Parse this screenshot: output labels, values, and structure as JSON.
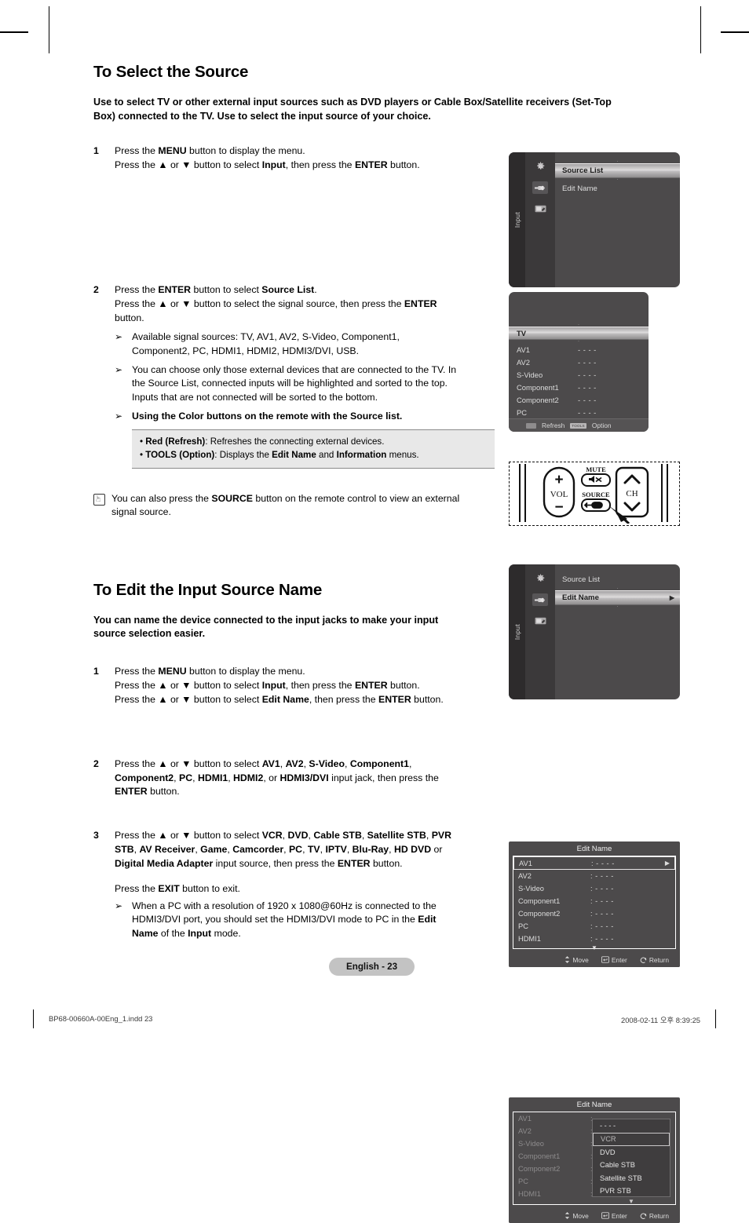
{
  "doc": {
    "page_badge": "English - 23",
    "footer_left": "BP68-00660A-00Eng_1.indd   23",
    "footer_right": "2008-02-11   오후 8:39:25"
  },
  "section1": {
    "title": "To Select the Source",
    "lead_line1": "Use to select TV or other external input sources such as DVD players or Cable Box/Satellite receivers (Set-Top",
    "lead_line2": "Box) connected to the TV. Use to select the input source of your choice.",
    "step1": {
      "num": "1",
      "line1_a": "Press the ",
      "line1_b": "MENU",
      "line1_c": " button to display the menu.",
      "line2_a": "Press the ▲ or ▼ button to select ",
      "line2_b": "Input",
      "line2_c": ", then press the ",
      "line2_d": "ENTER",
      "line2_e": " button."
    },
    "step2": {
      "num": "2",
      "line1_a": "Press the ",
      "line1_b": "ENTER",
      "line1_c": " button to select ",
      "line1_d": "Source List",
      "line1_e": ".",
      "line2_a": "Press the ▲ or ▼ button to select the signal source, then press the ",
      "line2_b": "ENTER",
      "line3": "button.",
      "bullet1_l1": "Available signal sources: TV,  AV1, AV2, S-Video, Component1,",
      "bullet1_l2": "Component2, PC, HDMI1, HDMI2, HDMI3/DVI, USB.",
      "bullet2_l1": "You can choose only those external devices that are connected to the TV. In",
      "bullet2_l2": "the Source List, connected inputs will be highlighted and sorted to the top.",
      "bullet2_l3": "Inputs that are not connected will be sorted to the bottom.",
      "bullet3": "Using the Color buttons on the remote with the Source list.",
      "info1_bold": "Red (Refresh)",
      "info1_rest": ": Refreshes the connecting external devices.",
      "info2_bold": "TOOLS (Option)",
      "info2_mid": ": Displays the ",
      "info2_b2": "Edit Name",
      "info2_mid2": " and ",
      "info2_b3": "Information",
      "info2_end": " menus."
    },
    "note": {
      "icon": "hand-pointer-icon",
      "l1_a": "You can also press the ",
      "l1_b": "SOURCE",
      "l1_c": " button on the remote control to view an external",
      "l2": "signal source."
    }
  },
  "section2": {
    "title": "To Edit the Input Source Name",
    "lead_line1": "You can name the device connected to the input jacks to make your input",
    "lead_line2": "source selection easier.",
    "step1": {
      "num": "1",
      "line1_a": "Press the ",
      "line1_b": "MENU",
      "line1_c": " button to display the menu.",
      "line2_a": "Press the ▲ or ▼ button to select ",
      "line2_b": "Input",
      "line2_c": ", then press the ",
      "line2_d": "ENTER",
      "line2_e": " button.",
      "line3_a": "Press the ▲ or ▼ button to select ",
      "line3_b": "Edit Name",
      "line3_c": ", then press the ",
      "line3_d": "ENTER",
      "line3_e": " button."
    },
    "step2": {
      "num": "2",
      "l1_a": "Press the ▲ or ▼ button to select ",
      "l1_b": "AV1",
      "l1_c": ", ",
      "l1_d": "AV2",
      "l1_e": ", ",
      "l1_f": "S-Video",
      "l1_g": ", ",
      "l1_h": "Component1",
      "l1_i": ",",
      "l2_a": "Component2",
      "l2_b": ", ",
      "l2_c": "PC",
      "l2_d": ", ",
      "l2_e": "HDMI1",
      "l2_f": ", ",
      "l2_g": "HDMI2",
      "l2_h": ", or ",
      "l2_i": "HDMI3/DVI",
      "l2_j": " input jack, then press the",
      "l3_a": "ENTER",
      "l3_b": " button."
    },
    "step3": {
      "num": "3",
      "l1_a": "Press the ▲ or ▼ button to select ",
      "l1_b": "VCR",
      "l1_c": ", ",
      "l1_d": "DVD",
      "l1_e": ", ",
      "l1_f": "Cable STB",
      "l1_g": ", ",
      "l1_h": "Satellite STB",
      "l1_i": ", ",
      "l1_j": "PVR",
      "l2_a": "STB",
      "l2_b": ", ",
      "l2_c": "AV Receiver",
      "l2_d": ", ",
      "l2_e": "Game",
      "l2_f": ", ",
      "l2_g": "Camcorder",
      "l2_h": ", ",
      "l2_i": "PC",
      "l2_j": ", ",
      "l2_k": "TV",
      "l2_l": ", ",
      "l2_m": "IPTV",
      "l2_n": ", ",
      "l2_o": "Blu-Ray",
      "l2_p": ", ",
      "l2_q": "HD DVD",
      "l2_r": " or",
      "l3_a": "Digital Media Adapter",
      "l3_b": " input source, then press the ",
      "l3_c": "ENTER",
      "l3_d": " button.",
      "exit_a": "Press the ",
      "exit_b": "EXIT",
      "exit_c": " button to exit.",
      "bullet_l1": "When a PC with a resolution of 1920 x 1080@60Hz is connected to the",
      "bullet_l2_a": "HDMI3/DVI port, you should set the HDMI3/DVI mode to PC in the ",
      "bullet_l2_b": "Edit",
      "bullet_l3_a": "Name",
      "bullet_l3_b": " of the ",
      "bullet_l3_c": "Input",
      "bullet_l3_d": " mode."
    }
  },
  "osd": {
    "input_menu_1": {
      "tab_label": "Input",
      "icons": [
        "gear-icon",
        "plug-icon",
        "edit-picture-icon"
      ],
      "items": [
        {
          "label": "Source List",
          "selected": true
        },
        {
          "label": "Edit Name",
          "selected": false
        }
      ]
    },
    "input_menu_2": {
      "tab_label": "Input",
      "icons": [
        "gear-icon",
        "plug-icon",
        "edit-picture-icon"
      ],
      "items": [
        {
          "label": "Source List",
          "selected": false
        },
        {
          "label": "Edit Name",
          "selected": true,
          "caret": "▶"
        }
      ]
    },
    "source_list": {
      "rows": [
        {
          "name": "TV",
          "value": "",
          "selected": true
        },
        {
          "name": "AV1",
          "value": "- - - -",
          "selected": false
        },
        {
          "name": "AV2",
          "value": "- - - -",
          "selected": false
        },
        {
          "name": "S-Video",
          "value": "- - - -",
          "selected": false
        },
        {
          "name": "Component1",
          "value": "- - - -",
          "selected": false
        },
        {
          "name": "Component2",
          "value": "- - - -",
          "selected": false
        },
        {
          "name": "PC",
          "value": "- - - -",
          "selected": false
        }
      ],
      "footer": {
        "refresh": "Refresh",
        "tools_key": "TOOLS",
        "option": "Option"
      }
    },
    "edit_name_list": {
      "title": "Edit Name",
      "rows": [
        {
          "name": "AV1",
          "value": ": - - - -",
          "selected": true,
          "caret": "▶"
        },
        {
          "name": "AV2",
          "value": ": - - - -",
          "selected": false
        },
        {
          "name": "S-Video",
          "value": ": - - - -",
          "selected": false
        },
        {
          "name": "Component1",
          "value": ": - - - -",
          "selected": false
        },
        {
          "name": "Component2",
          "value": ": - - - -",
          "selected": false
        },
        {
          "name": "PC",
          "value": ": - - - -",
          "selected": false
        },
        {
          "name": "HDMI1",
          "value": ": - - - -",
          "selected": false
        }
      ],
      "scroll_down": "▼",
      "footer": {
        "move": "Move",
        "enter": "Enter",
        "return": "Return"
      }
    },
    "edit_name_dropdown": {
      "title": "Edit Name",
      "rows": [
        {
          "name": "AV1",
          "value": ":"
        },
        {
          "name": "AV2",
          "value": ":"
        },
        {
          "name": "S-Video",
          "value": ":"
        },
        {
          "name": "Component1",
          "value": ":"
        },
        {
          "name": "Component2",
          "value": ":"
        },
        {
          "name": "PC",
          "value": ":"
        },
        {
          "name": "HDMI1",
          "value": ":"
        }
      ],
      "options": [
        {
          "label": "- - - -",
          "selected": false
        },
        {
          "label": "VCR",
          "selected": true
        },
        {
          "label": "DVD",
          "selected": false
        },
        {
          "label": "Cable STB",
          "selected": false
        },
        {
          "label": "Satellite STB",
          "selected": false
        },
        {
          "label": "PVR STB",
          "selected": false
        }
      ],
      "scroll_down": "▼",
      "footer": {
        "move": "Move",
        "enter": "Enter",
        "return": "Return"
      }
    }
  },
  "remote": {
    "vol_label": "VOL",
    "vol_plus": "+",
    "vol_minus": "−",
    "mute_label": "MUTE",
    "source_label": "SOURCE",
    "ch_label": "CH",
    "ch_up": "∧",
    "ch_down": "∨"
  }
}
